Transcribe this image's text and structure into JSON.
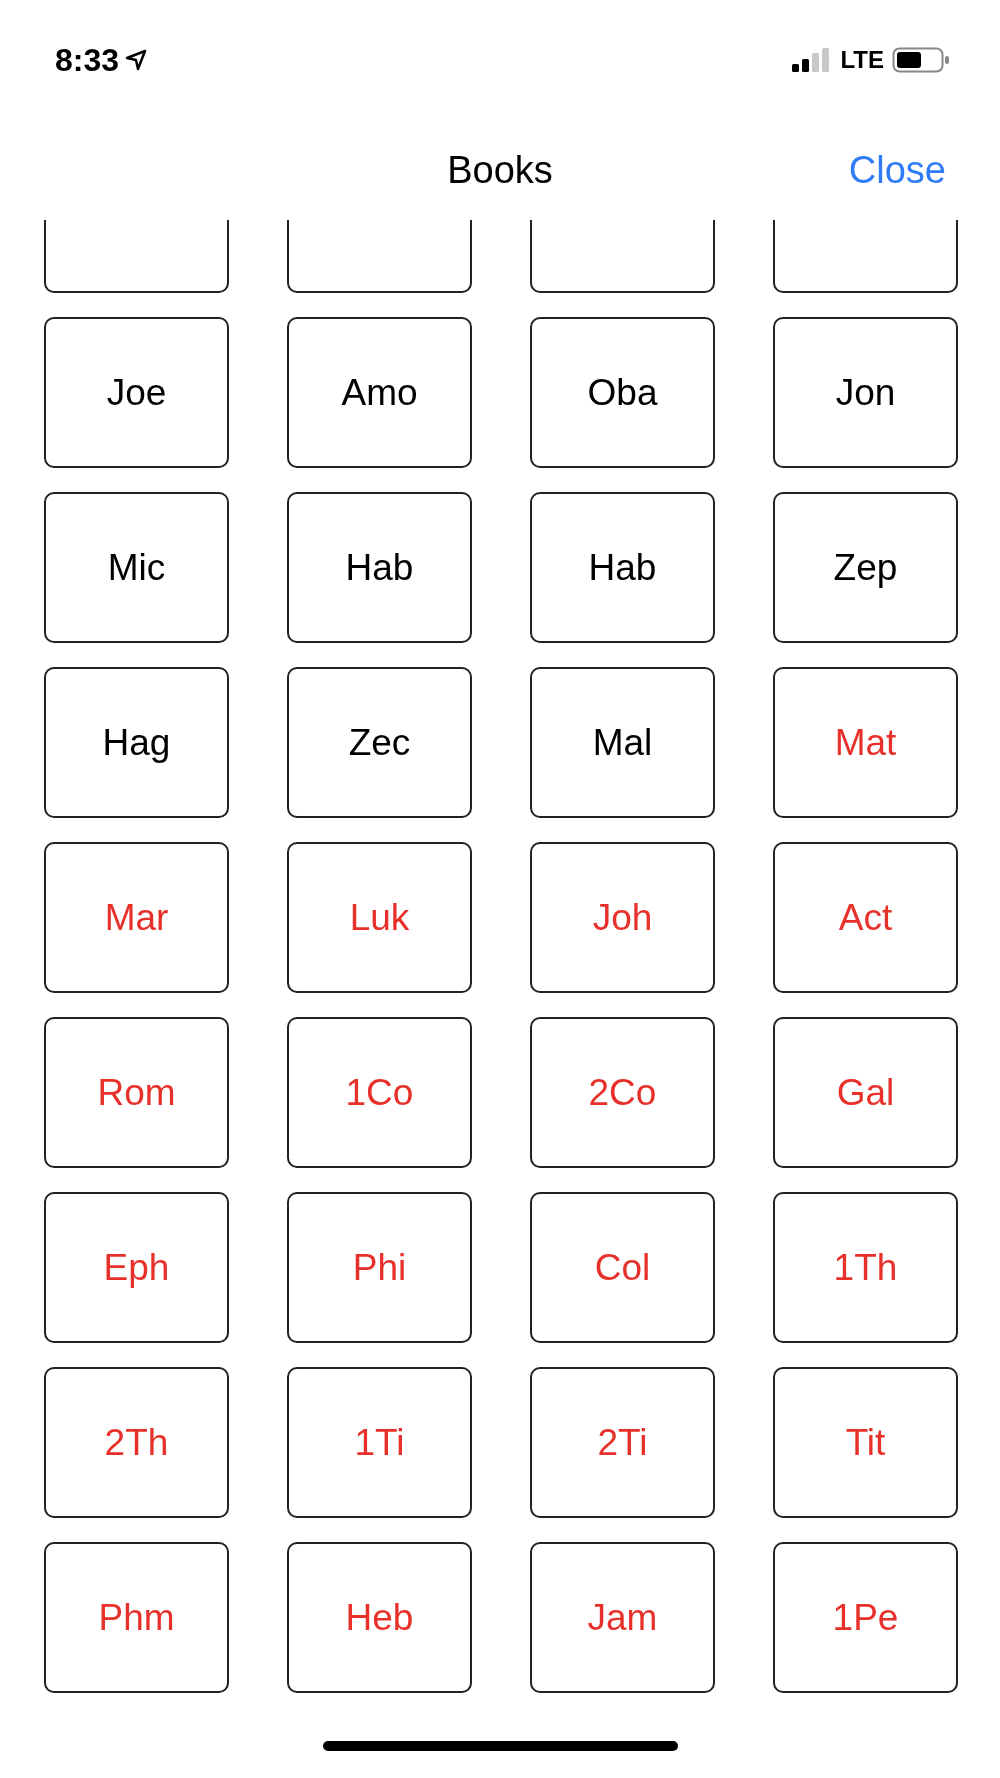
{
  "status_bar": {
    "time": "8:33",
    "network": "LTE"
  },
  "nav": {
    "title": "Books",
    "close": "Close"
  },
  "books": [
    {
      "kind": "cut"
    },
    {
      "kind": "cut"
    },
    {
      "kind": "cut"
    },
    {
      "kind": "cut"
    },
    {
      "kind": "full",
      "label": "Joe",
      "color": "#000000"
    },
    {
      "kind": "full",
      "label": "Amo",
      "color": "#000000"
    },
    {
      "kind": "full",
      "label": "Oba",
      "color": "#000000"
    },
    {
      "kind": "full",
      "label": "Jon",
      "color": "#000000"
    },
    {
      "kind": "full",
      "label": "Mic",
      "color": "#000000"
    },
    {
      "kind": "full",
      "label": "Hab",
      "color": "#000000"
    },
    {
      "kind": "full",
      "label": "Hab",
      "color": "#000000"
    },
    {
      "kind": "full",
      "label": "Zep",
      "color": "#000000"
    },
    {
      "kind": "full",
      "label": "Hag",
      "color": "#000000"
    },
    {
      "kind": "full",
      "label": "Zec",
      "color": "#000000"
    },
    {
      "kind": "full",
      "label": "Mal",
      "color": "#000000"
    },
    {
      "kind": "full",
      "label": "Mat",
      "color": "#e8302a"
    },
    {
      "kind": "full",
      "label": "Mar",
      "color": "#e8302a"
    },
    {
      "kind": "full",
      "label": "Luk",
      "color": "#e8302a"
    },
    {
      "kind": "full",
      "label": "Joh",
      "color": "#e8302a"
    },
    {
      "kind": "full",
      "label": "Act",
      "color": "#e8302a"
    },
    {
      "kind": "full",
      "label": "Rom",
      "color": "#e8302a"
    },
    {
      "kind": "full",
      "label": "1Co",
      "color": "#e8302a"
    },
    {
      "kind": "full",
      "label": "2Co",
      "color": "#e8302a"
    },
    {
      "kind": "full",
      "label": "Gal",
      "color": "#e8302a"
    },
    {
      "kind": "full",
      "label": "Eph",
      "color": "#e8302a"
    },
    {
      "kind": "full",
      "label": "Phi",
      "color": "#e8302a"
    },
    {
      "kind": "full",
      "label": "Col",
      "color": "#e8302a"
    },
    {
      "kind": "full",
      "label": "1Th",
      "color": "#e8302a"
    },
    {
      "kind": "full",
      "label": "2Th",
      "color": "#e8302a"
    },
    {
      "kind": "full",
      "label": "1Ti",
      "color": "#e8302a"
    },
    {
      "kind": "full",
      "label": "2Ti",
      "color": "#e8302a"
    },
    {
      "kind": "full",
      "label": "Tit",
      "color": "#e8302a"
    },
    {
      "kind": "full",
      "label": "Phm",
      "color": "#e8302a"
    },
    {
      "kind": "full",
      "label": "Heb",
      "color": "#e8302a"
    },
    {
      "kind": "full",
      "label": "Jam",
      "color": "#e8302a"
    },
    {
      "kind": "full",
      "label": "1Pe",
      "color": "#e8302a"
    }
  ]
}
